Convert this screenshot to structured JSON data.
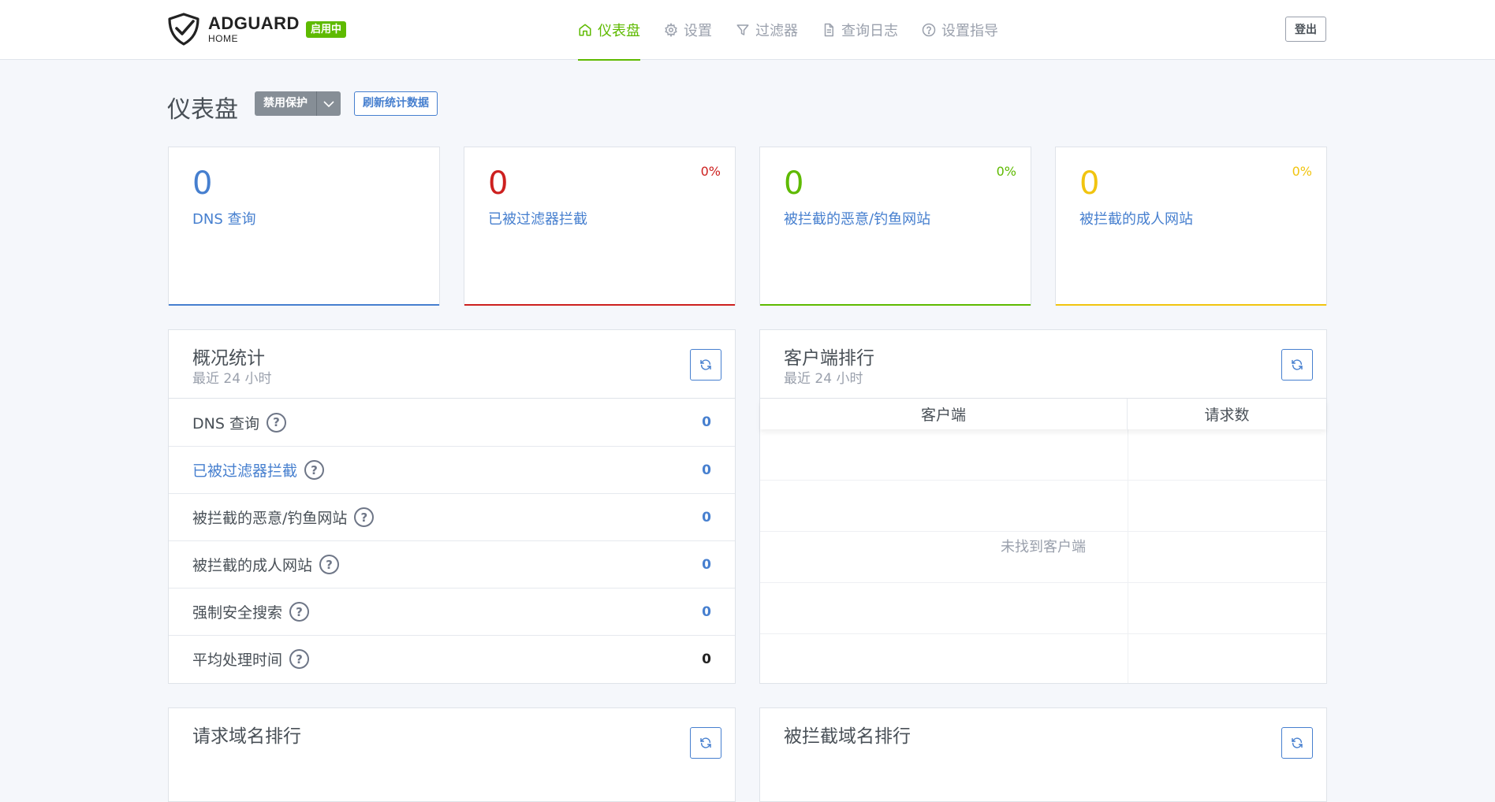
{
  "header": {
    "logo_name": "ADGUARD",
    "logo_sub": "HOME",
    "status_badge": "启用中",
    "nav": [
      {
        "label": "仪表盘",
        "icon": "home-icon",
        "active": true
      },
      {
        "label": "设置",
        "icon": "gear-icon",
        "active": false
      },
      {
        "label": "过滤器",
        "icon": "filter-icon",
        "active": false
      },
      {
        "label": "查询日志",
        "icon": "document-icon",
        "active": false
      },
      {
        "label": "设置指导",
        "icon": "help-circle-icon",
        "active": false
      }
    ],
    "logout_label": "登出"
  },
  "page": {
    "title": "仪表盘",
    "disable_protection_label": "禁用保护",
    "refresh_stats_label": "刷新统计数据"
  },
  "stat_cards": [
    {
      "value": "0",
      "label": "DNS 查询",
      "percent": "",
      "color": "#467fcf"
    },
    {
      "value": "0",
      "label": "已被过滤器拦截",
      "percent": "0%",
      "color": "#cd201f"
    },
    {
      "value": "0",
      "label": "被拦截的恶意/钓鱼网站",
      "percent": "0%",
      "color": "#5eba00"
    },
    {
      "value": "0",
      "label": "被拦截的成人网站",
      "percent": "0%",
      "color": "#f1c40f"
    }
  ],
  "overview": {
    "title": "概况统计",
    "subtitle": "最近 24 小时",
    "rows": [
      {
        "label": "DNS 查询",
        "value": "0"
      },
      {
        "label": "已被过滤器拦截",
        "value": "0"
      },
      {
        "label": "被拦截的恶意/钓鱼网站",
        "value": "0"
      },
      {
        "label": "被拦截的成人网站",
        "value": "0"
      },
      {
        "label": "强制安全搜索",
        "value": "0"
      },
      {
        "label": "平均处理时间",
        "value": "0"
      }
    ]
  },
  "clients": {
    "title": "客户端排行",
    "subtitle": "最近 24 小时",
    "col_client": "客户端",
    "col_requests": "请求数",
    "empty_text": "未找到客户端"
  },
  "bottom_panels": {
    "queried_domains_title": "请求域名排行",
    "blocked_domains_title": "被拦截域名排行"
  }
}
